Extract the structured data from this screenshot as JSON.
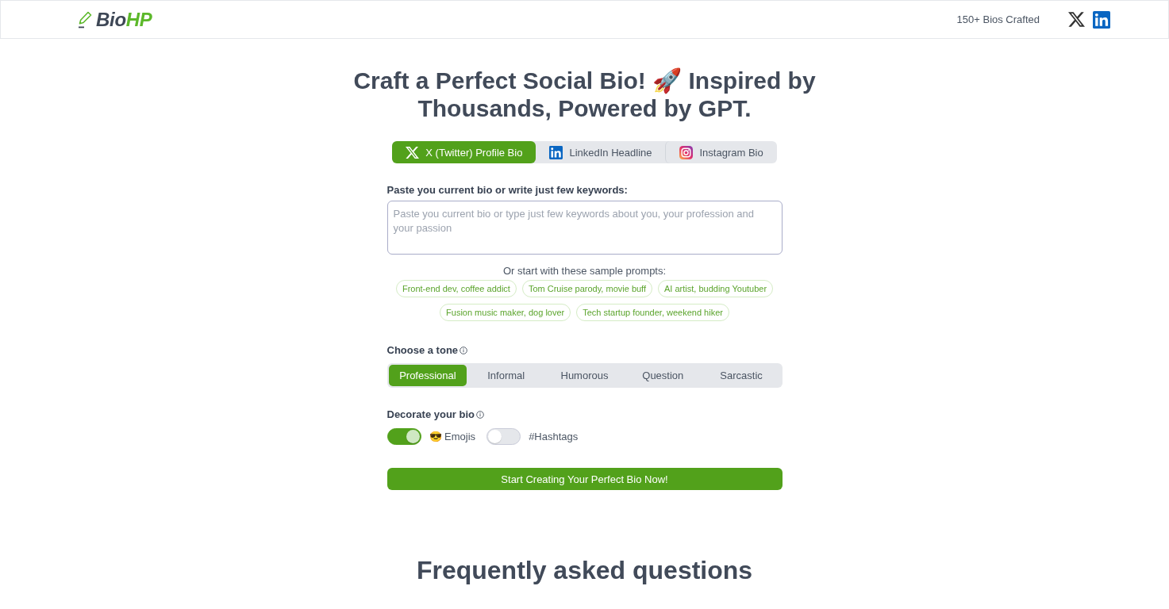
{
  "header": {
    "logo": {
      "text": "Bio",
      "accent": "HP"
    },
    "stat": "150+ Bios Crafted"
  },
  "hero": {
    "title": "Craft a Perfect Social Bio! 🚀 Inspired by Thousands, Powered by GPT."
  },
  "platform_tabs": [
    {
      "label": "X (Twitter) Profile Bio",
      "kind": "x",
      "selected": true
    },
    {
      "label": "LinkedIn Headline",
      "kind": "linkedin",
      "selected": false
    },
    {
      "label": "Instagram Bio",
      "kind": "instagram",
      "selected": false
    }
  ],
  "bio_input": {
    "label": "Paste you current bio or write just few keywords:",
    "placeholder": "Paste you current bio or type just few keywords about you, your profession and your passion"
  },
  "sample_prompts": {
    "intro": "Or start with these sample prompts:",
    "items": [
      "Front-end dev, coffee addict",
      "Tom Cruise parody, movie buff",
      "AI artist, budding Youtuber",
      "Fusion music maker, dog lover",
      "Tech startup founder, weekend hiker"
    ]
  },
  "tone": {
    "label": "Choose a tone",
    "options": [
      {
        "label": "Professional",
        "selected": true
      },
      {
        "label": "Informal",
        "selected": false
      },
      {
        "label": "Humorous",
        "selected": false
      },
      {
        "label": "Question",
        "selected": false
      },
      {
        "label": "Sarcastic",
        "selected": false
      }
    ]
  },
  "decorate": {
    "label": "Decorate your bio",
    "options": [
      {
        "label": "😎 Emojis",
        "on": true
      },
      {
        "label": "#Hashtags",
        "on": false
      }
    ]
  },
  "submit": {
    "label": "Start Creating Your Perfect Bio Now!"
  },
  "faq": {
    "title": "Frequently asked questions"
  }
}
